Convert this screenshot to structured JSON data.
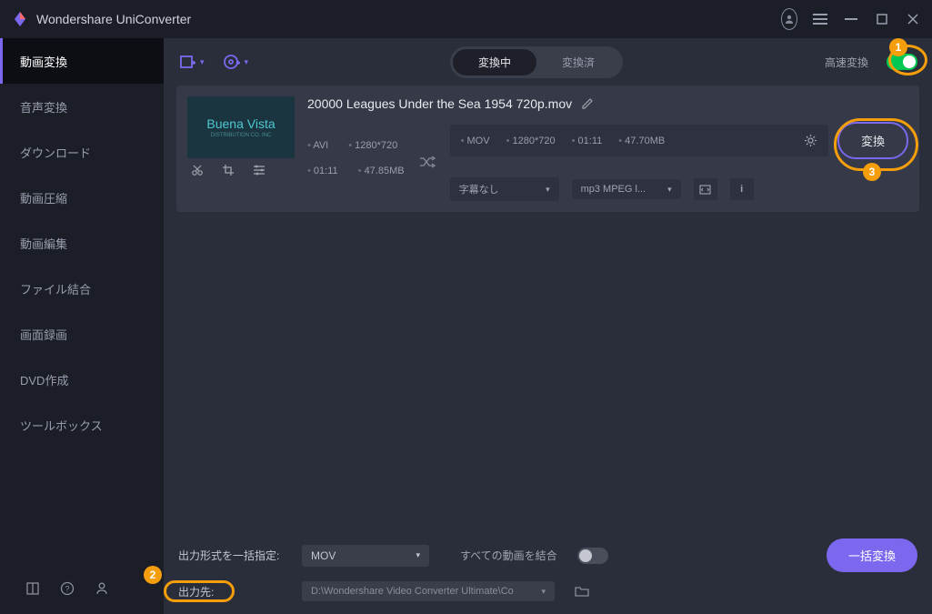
{
  "app": {
    "title": "Wondershare UniConverter"
  },
  "sidebar": {
    "items": [
      {
        "label": "動画変換"
      },
      {
        "label": "音声変換"
      },
      {
        "label": "ダウンロード"
      },
      {
        "label": "動画圧縮"
      },
      {
        "label": "動画編集"
      },
      {
        "label": "ファイル結合"
      },
      {
        "label": "画面録画"
      },
      {
        "label": "DVD作成"
      },
      {
        "label": "ツールボックス"
      }
    ]
  },
  "toolbar": {
    "tabs": {
      "converting": "変換中",
      "converted": "変換済"
    },
    "fast_label": "高速変換"
  },
  "file": {
    "name": "20000 Leagues Under the Sea 1954 720p.mov",
    "thumb_text": "Buena Vista",
    "thumb_sub": "DISTRIBUTION CO. INC",
    "src": {
      "format": "AVI",
      "res": "1280*720",
      "duration": "01:11",
      "size": "47.85MB"
    },
    "dst": {
      "format": "MOV",
      "res": "1280*720",
      "duration": "01:11",
      "size": "47.70MB"
    },
    "convert_btn": "変換",
    "subtitle_select": "字幕なし",
    "audio_select": "mp3 MPEG l...",
    "info_btn": "i"
  },
  "footer": {
    "format_label": "出力形式を一括指定:",
    "format_value": "MOV",
    "merge_label": "すべての動画を結合",
    "output_label": "出力先:",
    "output_path": "D:\\Wondershare Video Converter Ultimate\\Co",
    "batch_btn": "一括変換"
  },
  "callouts": {
    "n1": "1",
    "n2": "2",
    "n3": "3"
  }
}
